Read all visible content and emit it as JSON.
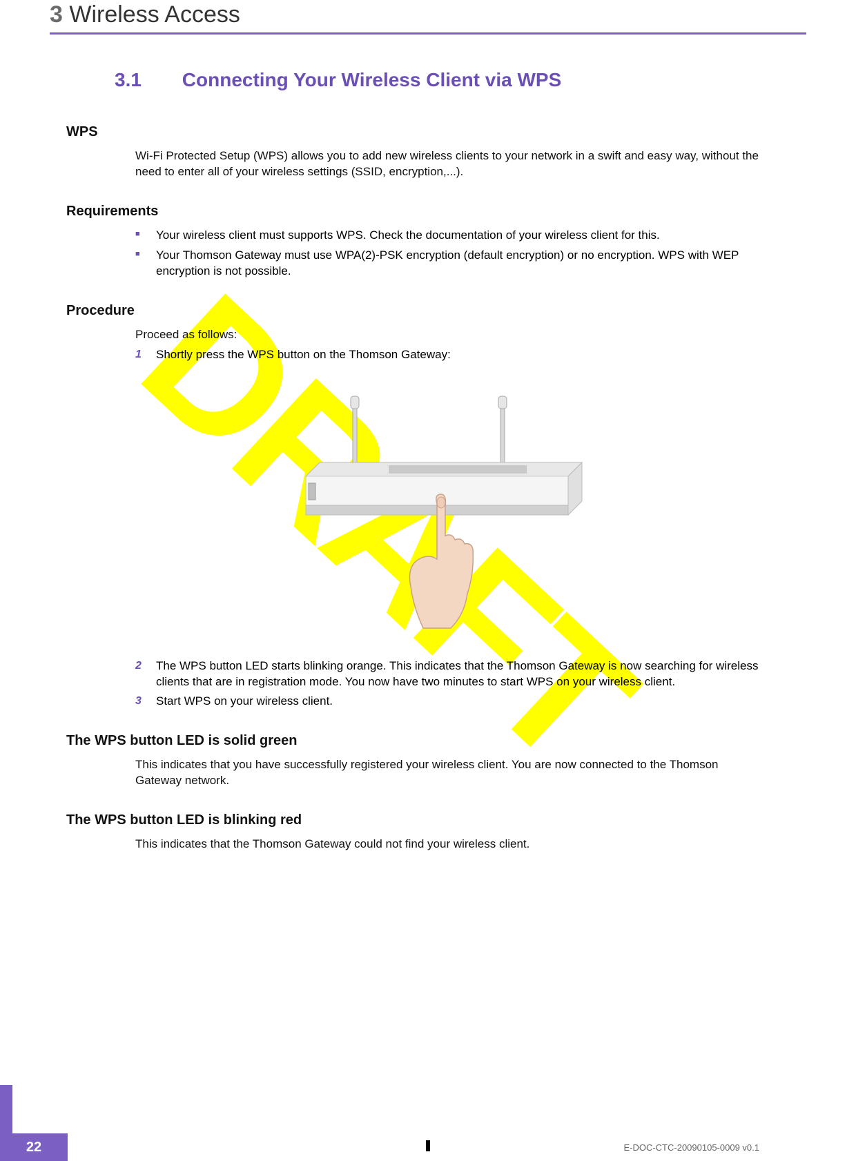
{
  "header": {
    "chapter_number": "3",
    "chapter_title": "Wireless Access"
  },
  "section": {
    "number": "3.1",
    "title": "Connecting Your Wireless Client via WPS"
  },
  "wps": {
    "heading": "WPS",
    "text": "Wi-Fi Protected Setup (WPS) allows you to add new wireless clients to your network in a swift and easy way, without the need to enter all of your wireless settings (SSID, encryption,...)."
  },
  "requirements": {
    "heading": "Requirements",
    "items": [
      "Your wireless client must supports WPS. Check the documentation of your wireless client for this.",
      "Your Thomson Gateway must use WPA(2)-PSK encryption (default encryption) or no encryption. WPS with WEP encryption is not possible."
    ]
  },
  "procedure": {
    "heading": "Procedure",
    "intro": "Proceed as follows:",
    "steps": [
      {
        "n": "1",
        "text": "Shortly press the WPS button on the Thomson Gateway:"
      },
      {
        "n": "2",
        "text": "The WPS button LED starts blinking orange. This indicates that the Thomson Gateway is now searching for wireless clients that are in registration mode. You now have two minutes to start WPS on your wireless client."
      },
      {
        "n": "3",
        "text": "Start WPS on your wireless client."
      }
    ]
  },
  "solid_green": {
    "heading": "The WPS button LED is solid green",
    "text": "This indicates that you have successfully registered your wireless client. You are now connected to the Thomson Gateway network."
  },
  "blinking_red": {
    "heading": "The WPS button LED is blinking red",
    "text": "This indicates that the Thomson Gateway could not find your wireless client."
  },
  "watermark": "DRAFT",
  "footer": {
    "page": "22",
    "doc_code": "E-DOC-CTC-20090105-0009 v0.1"
  }
}
